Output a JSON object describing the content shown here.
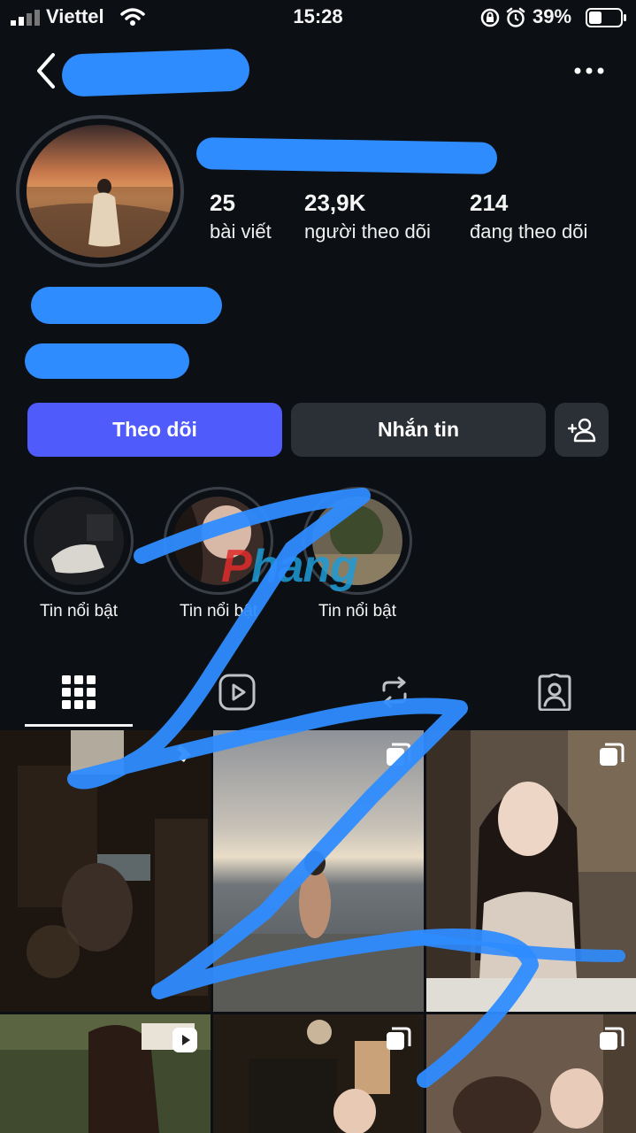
{
  "status": {
    "carrier": "Viettel",
    "time": "15:28",
    "battery_pct": "39%"
  },
  "profile": {
    "stats": [
      {
        "value": "25",
        "label": "bài viết"
      },
      {
        "value": "23,9K",
        "label": "người theo dõi"
      },
      {
        "value": "214",
        "label": "đang theo dõi"
      }
    ]
  },
  "actions": {
    "follow_label": "Theo dõi",
    "message_label": "Nhắn tin"
  },
  "highlights": [
    {
      "label": "Tin nổi bật"
    },
    {
      "label": "Tin nổi bật"
    },
    {
      "label": "Tin nổi bật"
    }
  ],
  "watermark": "Phang",
  "colors": {
    "background": "#0c1014",
    "follow_button": "#4f5bfb",
    "secondary_button": "#2b3036",
    "scribble": "#2f8cff"
  },
  "icons": {
    "tabs": [
      "grid-icon",
      "reels-icon",
      "reposts-icon",
      "tagged-icon"
    ],
    "header": [
      "back-icon",
      "more-icon"
    ],
    "add_friend": "add-person-icon"
  }
}
